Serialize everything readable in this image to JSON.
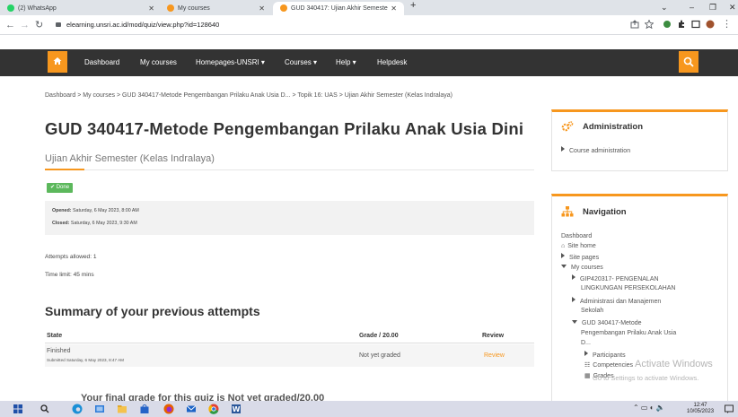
{
  "browser": {
    "tabs": [
      {
        "title": "(2) WhatsApp",
        "favicon_color": "#25d366"
      },
      {
        "title": "My courses",
        "favicon_color": "#f7971e"
      },
      {
        "title": "GUD 340417: Ujian Akhir Semeste",
        "favicon_color": "#f7971e"
      }
    ],
    "new_tab_label": "+",
    "url": "elearning.unsri.ac.id/mod/quiz/view.php?id=128640",
    "window_controls": {
      "minimize": "–",
      "maximize": "❐",
      "close": "✕",
      "chevron": "⌄"
    }
  },
  "navbar": {
    "items": [
      "Dashboard",
      "My courses",
      "Homepages-UNSRI ▾",
      "Courses ▾",
      "Help ▾",
      "Helpdesk"
    ],
    "accent_color": "#f7971e",
    "bg_color": "#333333"
  },
  "breadcrumb": "Dashboard > My courses > GUD 340417-Metode Pengembangan Prilaku Anak Usia D... > Topik 16: UAS > Ujian Akhir Semester (Kelas Indralaya)",
  "page": {
    "course_title": "GUD 340417-Metode Pengembangan Prilaku Anak Usia Dini",
    "quiz_title": "Ujian Akhir Semester (Kelas Indralaya)",
    "done_badge": "✔ Done",
    "opened_label": "Opened:",
    "opened_value": "Saturday, 6 May 2023, 8:00 AM",
    "closed_label": "Closed:",
    "closed_value": "Saturday, 6 May 2023, 9:30 AM",
    "attempts_allowed": "Attempts allowed: 1",
    "time_limit": "Time limit: 45 mins",
    "summary_heading": "Summary of your previous attempts",
    "table": {
      "headers": [
        "State",
        "Grade / 20.00",
        "Review"
      ],
      "rows": [
        {
          "state": "Finished",
          "submitted": "Submitted Saturday, 6 May 2023, 8:47 AM",
          "grade": "Not yet graded",
          "review": "Review"
        }
      ]
    },
    "cutoff_line": "Your final grade for this quiz is Not yet graded/20.00"
  },
  "admin_block": {
    "title": "Administration",
    "items": [
      "Course administration"
    ]
  },
  "nav_block": {
    "title": "Navigation",
    "dashboard": "Dashboard",
    "site_home": "Site home",
    "site_pages": "Site pages",
    "my_courses": "My courses",
    "course1": [
      "GIP420317- PENGENALAN",
      "LINGKUNGAN PERSEKOLAHAN"
    ],
    "course2": [
      "Administrasi dan Manajemen",
      "Sekolah"
    ],
    "course3": [
      "GUD 340417-Metode",
      "Pengembangan Prilaku Anak Usia",
      "D..."
    ],
    "participants": "Participants",
    "competencies": "Competencies",
    "grades": "Grades"
  },
  "watermark": {
    "line1": "Activate Windows",
    "line2": "Go to Settings to activate Windows."
  },
  "taskbar": {
    "time": "12:47",
    "date": "10/05/2023"
  }
}
